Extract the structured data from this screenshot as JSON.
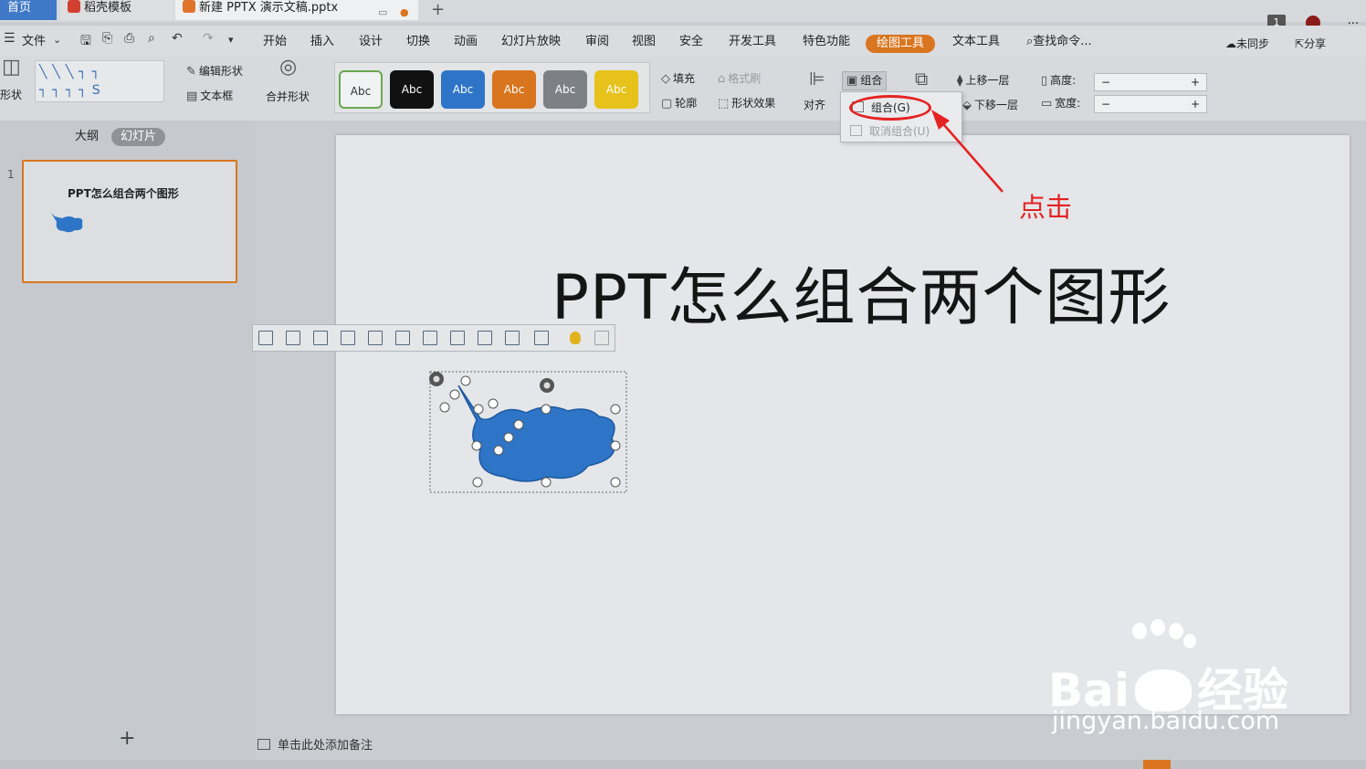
{
  "tabs": [
    {
      "label": "首页"
    },
    {
      "label": "稻壳模板"
    },
    {
      "label": "新建 PPTX 演示文稿.pptx"
    }
  ],
  "window": {
    "badge": "1",
    "more": "..."
  },
  "menu": {
    "file": "文件",
    "items": [
      "开始",
      "插入",
      "设计",
      "切换",
      "动画",
      "幻灯片放映",
      "审阅",
      "视图",
      "安全",
      "开发工具",
      "特色功能",
      "绘图工具",
      "文本工具"
    ],
    "active": "绘图工具",
    "search": "查找命令...",
    "sync": "未同步",
    "share": "分享"
  },
  "ribbon": {
    "shapes": "形状",
    "edit_shape": "编辑形状",
    "textbox": "文本框",
    "merge_shapes": "合并形状",
    "style_swatches": [
      {
        "label": "Abc",
        "color": "#f0f2f3",
        "text": "#333333",
        "border": "#6aa84f"
      },
      {
        "label": "Abc",
        "color": "#111111",
        "text": "#ffffff"
      },
      {
        "label": "Abc",
        "color": "#2e75c8",
        "text": "#ffffff"
      },
      {
        "label": "Abc",
        "color": "#d9751f",
        "text": "#ffffff"
      },
      {
        "label": "Abc",
        "color": "#7d8186",
        "text": "#ffffff"
      },
      {
        "label": "Abc",
        "color": "#e6c21a",
        "text": "#ffffff"
      }
    ],
    "fill": "填充",
    "format_painter": "格式刷",
    "outline": "轮廓",
    "shape_effects": "形状效果",
    "align": "对齐",
    "group": "组合",
    "bring_forward": "上移一层",
    "send_backward": "下移一层",
    "height_label": "高度:",
    "width_label": "宽度:",
    "minus": "−",
    "plus": "+"
  },
  "dropdown": {
    "group_item": "组合(G)",
    "ungroup_item": "取消组合(U)"
  },
  "callout": "点击",
  "left_panel": {
    "tab_outline": "大纲",
    "tab_slides": "幻灯片",
    "slide_number": "1",
    "thumb_title": "PPT怎么组合两个图形",
    "add": "+"
  },
  "slide": {
    "title": "PPT怎么组合两个图形",
    "shape_color": "#2e75c8"
  },
  "notes": "单击此处添加备注",
  "watermark": {
    "brand": "Bai",
    "brand2": "经验",
    "url": "jingyan.baidu.com"
  },
  "accent": "#d9751f"
}
